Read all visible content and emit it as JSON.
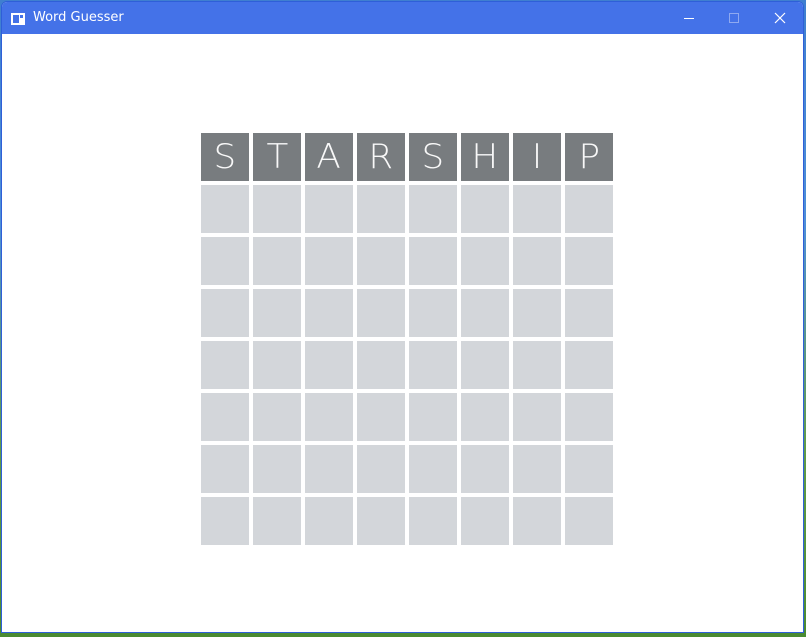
{
  "window": {
    "title": "Word Guesser",
    "controls": {
      "minimize_icon": "minimize-icon",
      "maximize_icon": "maximize-icon",
      "close_icon": "close-icon"
    }
  },
  "board": {
    "rows": [
      [
        "S",
        "T",
        "A",
        "R",
        "S",
        "H",
        "I",
        "P"
      ],
      [
        "",
        "",
        "",
        "",
        "",
        "",
        "",
        ""
      ],
      [
        "",
        "",
        "",
        "",
        "",
        "",
        "",
        ""
      ],
      [
        "",
        "",
        "",
        "",
        "",
        "",
        "",
        ""
      ],
      [
        "",
        "",
        "",
        "",
        "",
        "",
        "",
        ""
      ],
      [
        "",
        "",
        "",
        "",
        "",
        "",
        "",
        ""
      ],
      [
        "",
        "",
        "",
        "",
        "",
        "",
        "",
        ""
      ],
      [
        "",
        "",
        "",
        "",
        "",
        "",
        "",
        ""
      ]
    ],
    "colors": {
      "filled_tile": "#787c7f",
      "empty_tile": "#d3d6da",
      "letter": "#ffffff"
    }
  },
  "colors": {
    "titlebar": "#4472e8",
    "window_bg": "#ffffff"
  }
}
